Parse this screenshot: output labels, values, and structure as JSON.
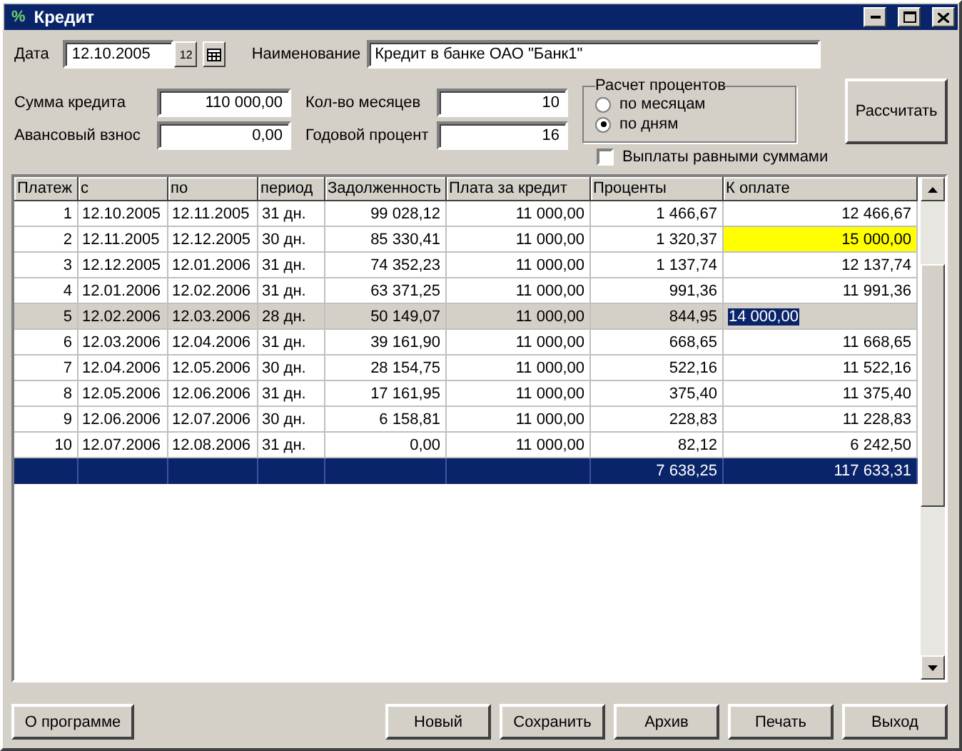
{
  "window": {
    "icon": "%",
    "title": "Кредит"
  },
  "form": {
    "date_label": "Дата",
    "date": "12.10.2005",
    "calendar_day": "12",
    "name_label": "Наименование",
    "name": "Кредит в банке ОАО \"Банк1\"",
    "amount_label": "Сумма кредита",
    "amount": "110 000,00",
    "months_label": "Кол-во месяцев",
    "months": "10",
    "advance_label": "Авансовый взнос",
    "advance": "0,00",
    "rate_label": "Годовой процент",
    "rate": "16"
  },
  "interest_calc": {
    "title": "Расчет процентов",
    "options": [
      {
        "label": "по месяцам",
        "selected": false
      },
      {
        "label": "по дням",
        "selected": true
      }
    ]
  },
  "equal_payments": {
    "label": "Выплаты равными суммами",
    "checked": false
  },
  "calculate_button": "Рассчитать",
  "table": {
    "columns": [
      "Платеж",
      "с",
      "по",
      "период",
      "Задолженность",
      "Плата за кредит",
      "Проценты",
      "К оплате"
    ],
    "rows": [
      {
        "cells": [
          "1",
          "12.10.2005",
          "12.11.2005",
          "31 дн.",
          "99 028,12",
          "11 000,00",
          "1 466,67",
          "12 466,67"
        ],
        "selected": false,
        "highlighted": false,
        "editing": false
      },
      {
        "cells": [
          "2",
          "12.11.2005",
          "12.12.2005",
          "30 дн.",
          "85 330,41",
          "11 000,00",
          "1 320,37",
          "15 000,00"
        ],
        "selected": false,
        "highlighted": true,
        "editing": false
      },
      {
        "cells": [
          "3",
          "12.12.2005",
          "12.01.2006",
          "31 дн.",
          "74 352,23",
          "11 000,00",
          "1 137,74",
          "12 137,74"
        ],
        "selected": false,
        "highlighted": false,
        "editing": false
      },
      {
        "cells": [
          "4",
          "12.01.2006",
          "12.02.2006",
          "31 дн.",
          "63 371,25",
          "11 000,00",
          "991,36",
          "11 991,36"
        ],
        "selected": false,
        "highlighted": false,
        "editing": false
      },
      {
        "cells": [
          "5",
          "12.02.2006",
          "12.03.2006",
          "28 дн.",
          "50 149,07",
          "11 000,00",
          "844,95",
          "14 000,00"
        ],
        "selected": true,
        "highlighted": false,
        "editing": true
      },
      {
        "cells": [
          "6",
          "12.03.2006",
          "12.04.2006",
          "31 дн.",
          "39 161,90",
          "11 000,00",
          "668,65",
          "11 668,65"
        ],
        "selected": false,
        "highlighted": false,
        "editing": false
      },
      {
        "cells": [
          "7",
          "12.04.2006",
          "12.05.2006",
          "30 дн.",
          "28 154,75",
          "11 000,00",
          "522,16",
          "11 522,16"
        ],
        "selected": false,
        "highlighted": false,
        "editing": false
      },
      {
        "cells": [
          "8",
          "12.05.2006",
          "12.06.2006",
          "31 дн.",
          "17 161,95",
          "11 000,00",
          "375,40",
          "11 375,40"
        ],
        "selected": false,
        "highlighted": false,
        "editing": false
      },
      {
        "cells": [
          "9",
          "12.06.2006",
          "12.07.2006",
          "30 дн.",
          "6 158,81",
          "11 000,00",
          "228,83",
          "11 228,83"
        ],
        "selected": false,
        "highlighted": false,
        "editing": false
      },
      {
        "cells": [
          "10",
          "12.07.2006",
          "12.08.2006",
          "31 дн.",
          "0,00",
          "11 000,00",
          "82,12",
          "6 242,50"
        ],
        "selected": false,
        "highlighted": false,
        "editing": false
      }
    ],
    "totals": {
      "interest": "7 638,25",
      "payment": "117 633,31"
    }
  },
  "buttons": {
    "left": [
      "О программе"
    ],
    "right": [
      "Новый",
      "Сохранить",
      "Архив",
      "Печать",
      "Выход"
    ]
  }
}
